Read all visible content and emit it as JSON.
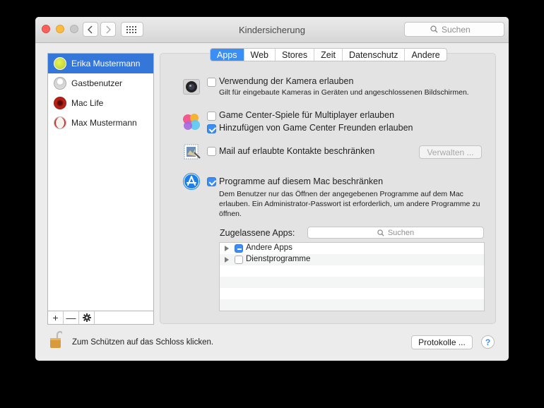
{
  "window": {
    "title": "Kindersicherung",
    "search_placeholder": "Suchen"
  },
  "users": [
    {
      "name": "Erika Mustermann",
      "selected": true,
      "avatar": "tennis-ball-avatar"
    },
    {
      "name": "Gastbenutzer",
      "selected": false,
      "avatar": "guest-avatar"
    },
    {
      "name": "Mac Life",
      "selected": false,
      "avatar": "red-flower-avatar"
    },
    {
      "name": "Max Mustermann",
      "selected": false,
      "avatar": "baseball-avatar"
    }
  ],
  "list_actions": {
    "add": "+",
    "remove": "—"
  },
  "tabs": [
    "Apps",
    "Web",
    "Stores",
    "Zeit",
    "Datenschutz",
    "Andere"
  ],
  "active_tab": "Apps",
  "settings": {
    "camera": {
      "label": "Verwendung der Kamera erlauben",
      "checked": false,
      "desc": "Gilt für eingebaute Kameras in Geräten und angeschlossenen Bildschirmen."
    },
    "gamecenter_multiplayer": {
      "label": "Game Center-Spiele für Multiplayer erlauben",
      "checked": false
    },
    "gamecenter_friends": {
      "label": "Hinzufügen von Game Center Freunden erlauben",
      "checked": true
    },
    "mail": {
      "label": "Mail auf erlaubte Kontakte beschränken",
      "checked": false,
      "button": "Verwalten ..."
    },
    "programs": {
      "label": "Programme auf diesem Mac beschränken",
      "checked": true,
      "desc_line1": "Dem Benutzer nur das Öffnen der angegebenen Programme auf dem Mac",
      "desc_line2": "erlauben. Ein Administrator-Passwort ist erforderlich, um andere Programme zu",
      "desc_line3": "öffnen."
    }
  },
  "allowed_apps": {
    "label": "Zugelassene Apps:",
    "search_placeholder": "Suchen",
    "items": [
      {
        "name": "Andere Apps",
        "state": "mixed"
      },
      {
        "name": "Dienstprogramme",
        "state": "unchecked"
      }
    ]
  },
  "footer": {
    "lock_text": "Zum Schützen auf das Schloss klicken.",
    "logs_button": "Protokolle ...",
    "help": "?"
  },
  "colors": {
    "accent": "#3b8ef3",
    "selection": "#3477d9"
  }
}
